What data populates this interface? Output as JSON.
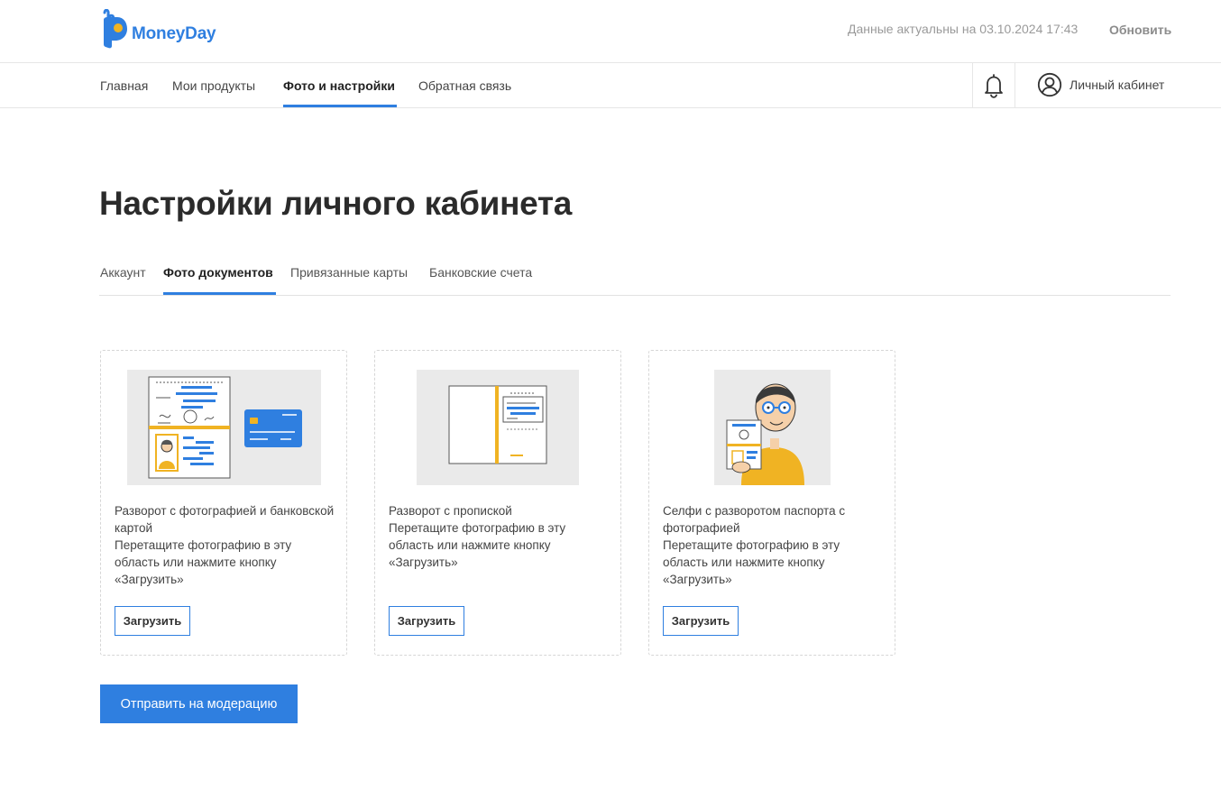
{
  "header": {
    "logo_text": "MoneyDay",
    "data_status": "Данные актуальны на 03.10.2024 17:43",
    "refresh_label": "Обновить"
  },
  "nav": {
    "items": [
      {
        "label": "Главная"
      },
      {
        "label": "Мои продукты"
      },
      {
        "label": "Фото и настройки",
        "active": true
      },
      {
        "label": "Обратная связь"
      }
    ],
    "notifications_icon": "bell-icon",
    "account_icon": "user-circle-icon",
    "account_label": "Личный кабинет"
  },
  "page": {
    "title": "Настройки личного кабинета"
  },
  "tabs": [
    {
      "label": "Аккаунт"
    },
    {
      "label": "Фото документов",
      "active": true
    },
    {
      "label": "Привязанные карты"
    },
    {
      "label": "Банковские счета"
    }
  ],
  "cards": [
    {
      "title": "Разворот с фотографией и банковской картой",
      "hint": "Перетащите фотографию в эту область или нажмите кнопку «Загрузить»",
      "button": "Загрузить",
      "image": "passport-and-card-illustration"
    },
    {
      "title": "Разворот с пропиской",
      "hint": "Перетащите фотографию в эту область или нажмите кнопку «Загрузить»",
      "button": "Загрузить",
      "image": "passport-registration-illustration"
    },
    {
      "title": "Селфи с разворотом паспорта с фотографией",
      "hint": "Перетащите фотографию в эту область или нажмите кнопку «Загрузить»",
      "button": "Загрузить",
      "image": "selfie-with-passport-illustration"
    }
  ],
  "submit_label": "Отправить на модерацию",
  "colors": {
    "accent": "#2f7fe0",
    "illustration_bg": "#eaeaea",
    "illustration_yellow": "#f0b323"
  }
}
